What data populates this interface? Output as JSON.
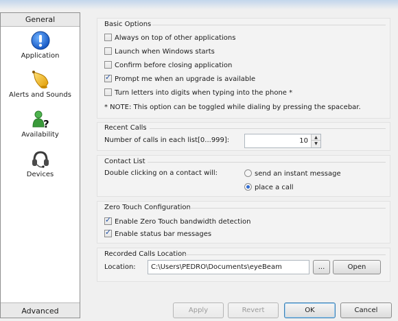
{
  "sidebar": {
    "top_label": "General",
    "bottom_label": "Advanced",
    "items": [
      {
        "label": "Application",
        "icon": "info-icon"
      },
      {
        "label": "Alerts and Sounds",
        "icon": "bell-icon"
      },
      {
        "label": "Availability",
        "icon": "availability-person-icon"
      },
      {
        "label": "Devices",
        "icon": "headset-icon"
      }
    ]
  },
  "basic_options": {
    "title": "Basic Options",
    "checkboxes": [
      {
        "label": "Always on top of other applications",
        "checked": false
      },
      {
        "label": "Launch when Windows starts",
        "checked": false
      },
      {
        "label": "Confirm before closing application",
        "checked": false
      },
      {
        "label": "Prompt me when an upgrade is available",
        "checked": true
      },
      {
        "label": "Turn letters into digits when typing into the phone *",
        "checked": false
      }
    ],
    "note": "* NOTE: This option can be toggled while dialing by pressing the spacebar."
  },
  "recent_calls": {
    "title": "Recent Calls",
    "label": "Number of calls in each list[0...999]:",
    "value": "10"
  },
  "contact_list": {
    "title": "Contact List",
    "label": "Double clicking on a contact will:",
    "options": [
      {
        "label": "send an instant message",
        "selected": false
      },
      {
        "label": "place a call",
        "selected": true
      }
    ]
  },
  "zero_touch": {
    "title": "Zero Touch Configuration",
    "checkboxes": [
      {
        "label": "Enable Zero Touch bandwidth detection",
        "checked": true
      },
      {
        "label": "Enable status bar messages",
        "checked": true
      }
    ]
  },
  "recorded_calls": {
    "title": "Recorded Calls Location",
    "label": "Location:",
    "path": "C:\\Users\\PEDRO\\Documents\\eyeBeam",
    "browse_label": "...",
    "open_label": "Open"
  },
  "footer": {
    "apply_label": "Apply",
    "revert_label": "Revert",
    "ok_label": "OK",
    "cancel_label": "Cancel"
  },
  "colors": {
    "accent_blue": "#1f6fd6",
    "bell_yellow": "#f2b418",
    "person_green": "#3a9a3a"
  }
}
